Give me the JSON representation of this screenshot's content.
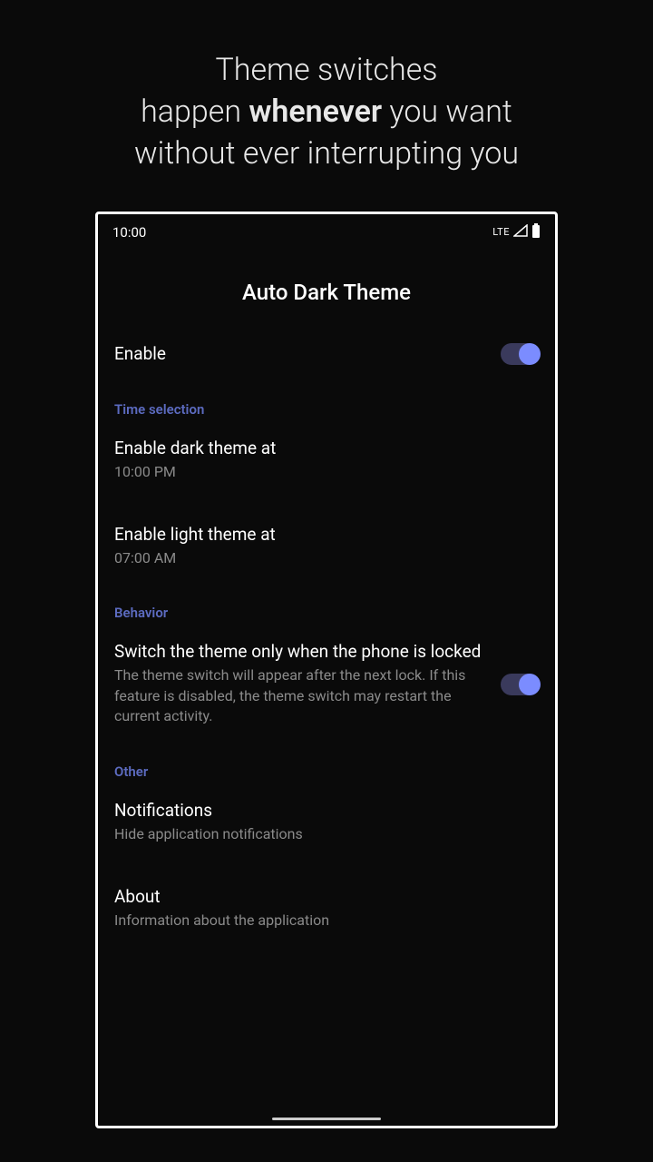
{
  "promo": {
    "line1": "Theme switches",
    "line2a": "happen ",
    "line2b": "whenever",
    "line2c": " you want",
    "line3": "without ever interrupting you"
  },
  "status": {
    "time": "10:00",
    "network": "LTE"
  },
  "screen": {
    "title": "Auto Dark Theme",
    "enable": {
      "label": "Enable"
    },
    "sections": {
      "time_selection": {
        "header": "Time selection",
        "dark": {
          "title": "Enable dark theme at",
          "value": "10:00 PM"
        },
        "light": {
          "title": "Enable light theme at",
          "value": "07:00 AM"
        }
      },
      "behavior": {
        "header": "Behavior",
        "lock": {
          "title": "Switch the theme only when the phone is locked",
          "sub": "The theme switch will appear after the next lock. If this feature is disabled, the theme switch may restart the current activity."
        }
      },
      "other": {
        "header": "Other",
        "notifications": {
          "title": "Notifications",
          "sub": "Hide application notifications"
        },
        "about": {
          "title": "About",
          "sub": "Information about the application"
        }
      }
    }
  }
}
